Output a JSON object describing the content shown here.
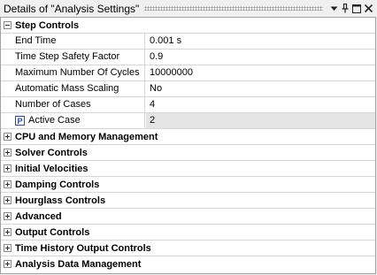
{
  "title": "Details of \"Analysis Settings\"",
  "titlebar_icons": [
    "chevron-down-icon",
    "pin-icon",
    "maximize-icon",
    "close-icon"
  ],
  "sections": {
    "step_controls": {
      "label": "Step Controls",
      "rows": [
        {
          "name": "End Time",
          "value": "0.001 s"
        },
        {
          "name": "Time Step Safety Factor",
          "value": "0.9"
        },
        {
          "name": "Maximum Number Of Cycles",
          "value": "10000000"
        },
        {
          "name": "Automatic Mass Scaling",
          "value": "No"
        },
        {
          "name": "Number of Cases",
          "value": "4"
        },
        {
          "name": "Active Case",
          "value": "2",
          "badge": "P"
        }
      ]
    },
    "collapsed": [
      {
        "label": "CPU and Memory Management"
      },
      {
        "label": "Solver Controls"
      },
      {
        "label": "Initial Velocities"
      },
      {
        "label": "Damping Controls"
      },
      {
        "label": "Hourglass Controls"
      },
      {
        "label": "Advanced"
      },
      {
        "label": "Output Controls"
      },
      {
        "label": "Time History Output Controls"
      },
      {
        "label": "Analysis Data Management"
      }
    ]
  }
}
